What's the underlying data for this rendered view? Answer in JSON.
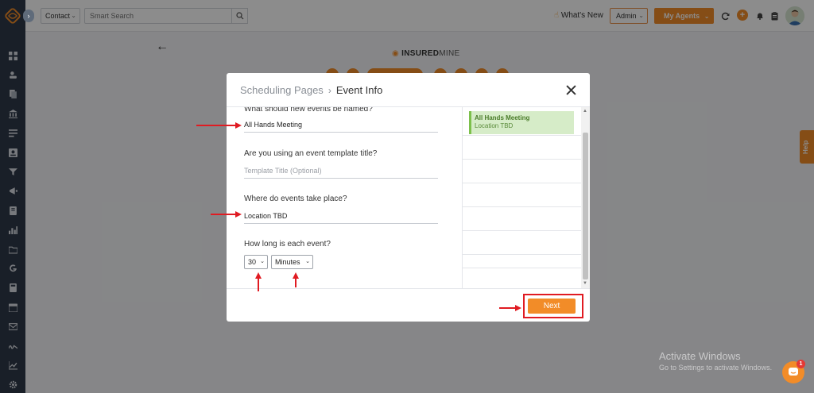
{
  "topbar": {
    "contact_label": "Contact",
    "search_placeholder": "Smart Search",
    "whats_new_label": "What's New",
    "admin_label": "Admin",
    "my_agents_label": "My Agents"
  },
  "background": {
    "brand_bold": "INSURED",
    "brand_light": "MINE",
    "help_label": "Help"
  },
  "modal": {
    "breadcrumb_parent": "Scheduling Pages",
    "breadcrumb_current": "Event Info",
    "questions": {
      "event_name_label": "What should new events be named?",
      "event_name_value": "All Hands Meeting",
      "template_label": "Are you using an event template title?",
      "template_placeholder": "Template Title (Optional)",
      "location_label": "Where do events take place?",
      "location_value": "Location TBD",
      "duration_label": "How long is each event?",
      "duration_value": "30",
      "duration_unit": "Minutes"
    },
    "calendar_preview": {
      "event_title": "All Hands Meeting",
      "event_location": "Location TBD"
    },
    "next_label": "Next"
  },
  "watermark": {
    "title": "Activate Windows",
    "subtitle": "Go to Settings to activate Windows."
  },
  "chat": {
    "badge_count": "1"
  },
  "colors": {
    "accent": "#f28c28",
    "sidebar": "#2f3a4a",
    "annotation": "#e01b22",
    "event_bg": "#d6ecc8"
  }
}
